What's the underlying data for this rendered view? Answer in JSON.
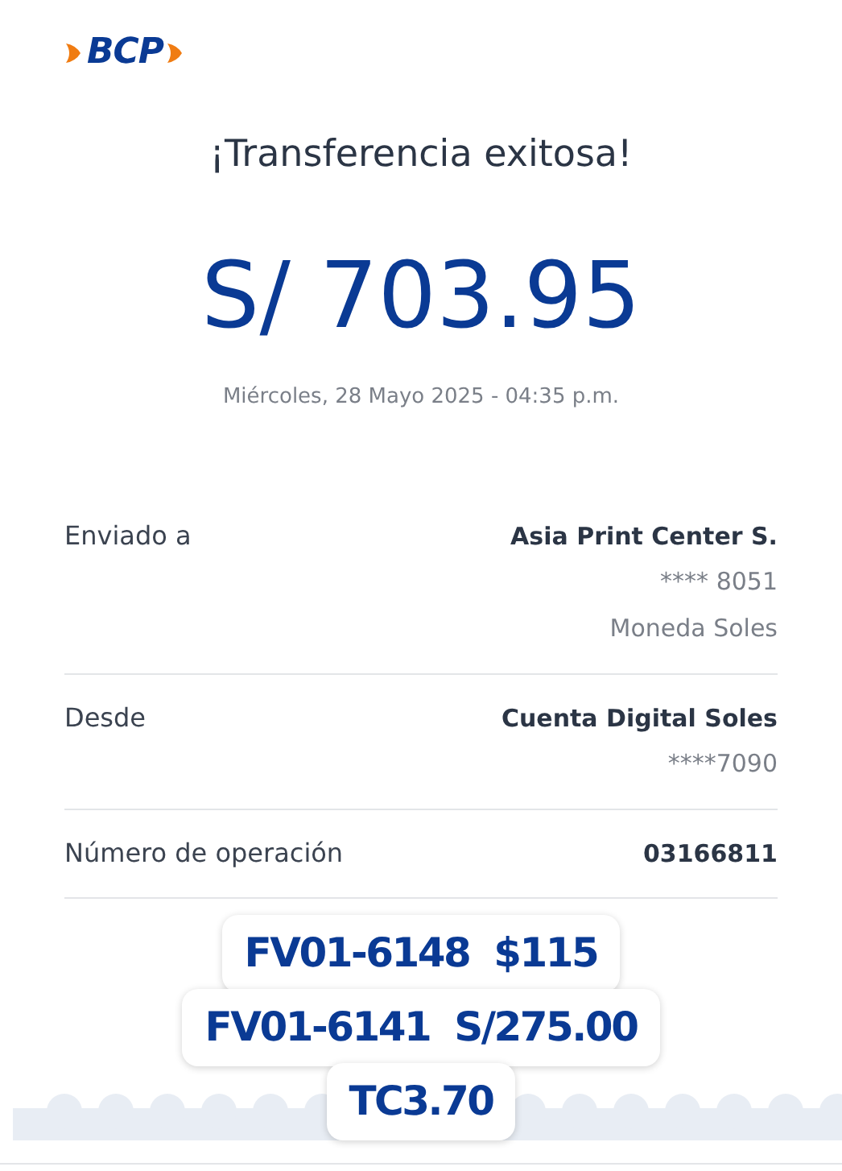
{
  "logo": {
    "text": "BCP"
  },
  "title": "¡Transferencia exitosa!",
  "amount": "S/ 703.95",
  "date": "Miércoles, 28 Mayo 2025 - 04:35 p.m.",
  "details": [
    {
      "label": "Enviado a",
      "value": "Asia Print Center S.",
      "sublines": [
        "**** 8051",
        "Moneda Soles"
      ]
    },
    {
      "label": "Desde",
      "value": "Cuenta Digital Soles",
      "sublines": [
        "****7090"
      ]
    },
    {
      "label": "Número de operación",
      "value": "03166811"
    }
  ],
  "notes": [
    "FV01-6148  $115",
    "FV01-6141  S/275.00",
    "TC3.70"
  ]
}
